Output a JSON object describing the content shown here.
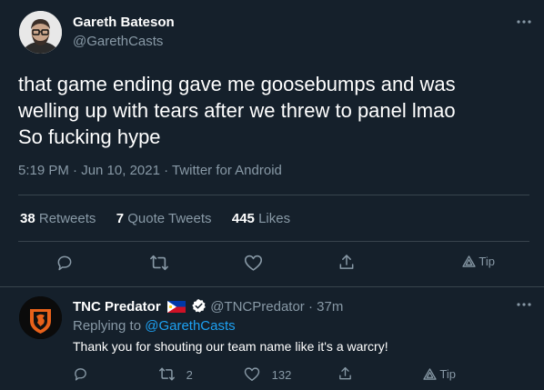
{
  "main_tweet": {
    "author_name": "Gareth Bateson",
    "author_handle": "@GarethCasts",
    "text_line1": "that game ending gave me goosebumps and was",
    "text_line2": "welling up with tears after we threw to panel lmao",
    "text_line3": "So fucking hype",
    "meta": "5:19 PM · Jun 10, 2021 · Twitter for Android",
    "stats": {
      "retweets_count": "38",
      "retweets_label": "Retweets",
      "quotes_count": "7",
      "quotes_label": "Quote Tweets",
      "likes_count": "445",
      "likes_label": "Likes"
    },
    "tip_label": "Tip"
  },
  "reply_tweet": {
    "author_name": "TNC Predator",
    "flag": "🇵🇭",
    "author_handle": "@TNCPredator",
    "time": "· 37m",
    "replying_prefix": "Replying to",
    "replying_handle": "@GarethCasts",
    "text": "Thank you for shouting our team name like it's a warcry!",
    "retweet_count": "2",
    "like_count": "132",
    "tip_label": "Tip"
  },
  "colors": {
    "background": "#15202b",
    "muted": "#8899a6",
    "link": "#1da1f2",
    "divider": "#38444d",
    "tnc_orange": "#e8611a"
  }
}
